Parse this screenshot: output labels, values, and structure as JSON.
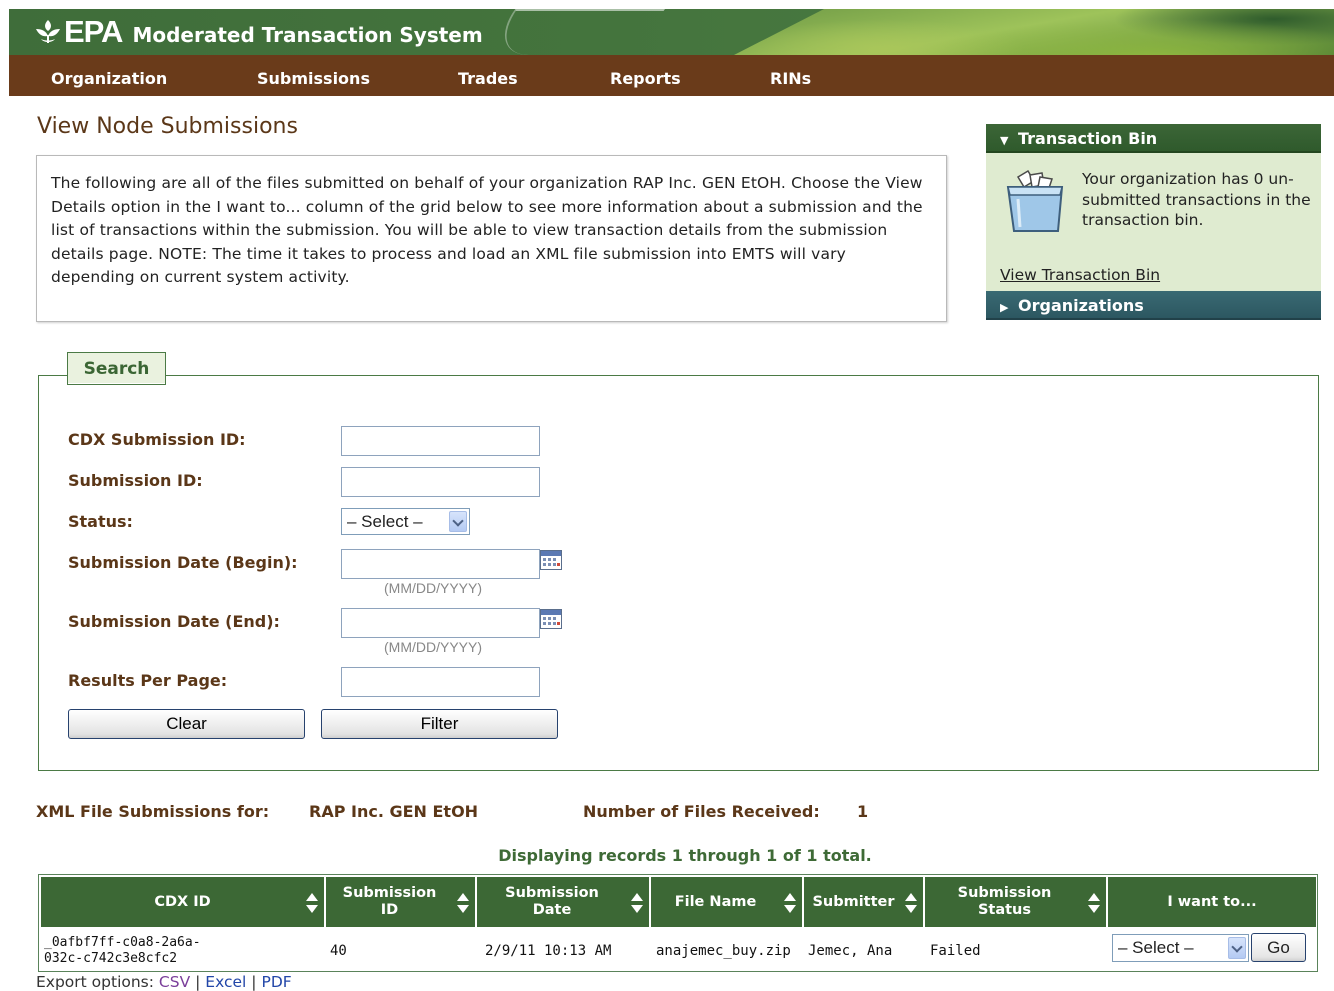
{
  "header": {
    "logo_text": "EPA",
    "system_title": "Moderated Transaction System"
  },
  "nav": {
    "items": [
      "Organization",
      "Submissions",
      "Trades",
      "Reports",
      "RINs"
    ]
  },
  "page": {
    "title": "View Node Submissions",
    "intro": "The following are all of the files submitted on behalf of your organization RAP Inc. GEN EtOH. Choose the View Details option in the I want to... column of the grid below to see more information about a submission and the list of transactions within the submission. You will be able to view transaction details from the submission details page. NOTE: The time it takes to process and load an XML file submission into EMTS will vary depending on current system activity."
  },
  "transaction_bin": {
    "header": "Transaction Bin",
    "message": "Your organization has 0 un-submitted transactions in the transaction bin.",
    "link": "View Transaction Bin",
    "organizations_header": "Organizations"
  },
  "search": {
    "legend": "Search",
    "labels": {
      "cdx_submission_id": "CDX Submission ID:",
      "submission_id": "Submission ID:",
      "status": "Status:",
      "date_begin": "Submission Date (Begin):",
      "date_end": "Submission Date (End):",
      "results_per_page": "Results Per Page:"
    },
    "values": {
      "cdx_submission_id": "",
      "submission_id": "",
      "status": "– Select –",
      "date_begin": "",
      "date_end": "",
      "results_per_page": ""
    },
    "date_hint": "(MM/DD/YYYY)",
    "clear_label": "Clear",
    "filter_label": "Filter"
  },
  "results": {
    "submissions_for_label": "XML File Submissions for:",
    "organization": "RAP Inc. GEN EtOH",
    "files_received_label": "Number of Files Received:",
    "files_received": "1",
    "display_message": "Displaying records 1 through 1 of 1 total.",
    "columns": [
      "CDX ID",
      "Submission ID",
      "Submission Date",
      "File Name",
      "Submitter",
      "Submission Status",
      "I want to..."
    ],
    "rows": [
      {
        "cdx_id_line1": "_0afbf7ff-c0a8-2a6a-",
        "cdx_id_line2": "032c-c742c3e8cfc2",
        "submission_id": "40",
        "submission_date": "2/9/11 10:13 AM",
        "file_name": "anajemec_buy.zip",
        "submitter": "Jemec, Ana",
        "status": "Failed",
        "action_select": "– Select –",
        "go_label": "Go"
      }
    ]
  },
  "export": {
    "label": "Export options:",
    "csv": "CSV",
    "excel": "Excel",
    "pdf": "PDF",
    "separator": "|"
  },
  "colors": {
    "header_green": "#44743d",
    "nav_brown": "#6a3b1a",
    "label_brown": "#5b3718",
    "grid_header_green": "#3c6835",
    "bin_body": "#dfebd0",
    "org_header_teal": "#2c5761"
  }
}
